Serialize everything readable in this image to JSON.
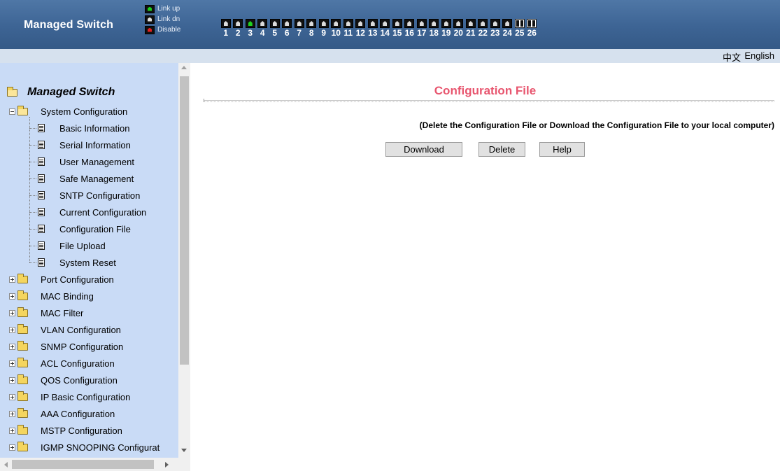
{
  "header": {
    "brand": "Managed Switch",
    "legend": [
      {
        "label": "Link up",
        "color": "#1fd11f"
      },
      {
        "label": "Link dn",
        "color": "#dcdcdc"
      },
      {
        "label": "Disable",
        "color": "#e02020"
      }
    ],
    "ports": [
      {
        "num": "1",
        "state": "down"
      },
      {
        "num": "2",
        "state": "down"
      },
      {
        "num": "3",
        "state": "up"
      },
      {
        "num": "4",
        "state": "down"
      },
      {
        "num": "5",
        "state": "down"
      },
      {
        "num": "6",
        "state": "down"
      },
      {
        "num": "7",
        "state": "down"
      },
      {
        "num": "8",
        "state": "down"
      },
      {
        "num": "9",
        "state": "down"
      },
      {
        "num": "10",
        "state": "down"
      },
      {
        "num": "11",
        "state": "down"
      },
      {
        "num": "12",
        "state": "down"
      },
      {
        "num": "13",
        "state": "down"
      },
      {
        "num": "14",
        "state": "down"
      },
      {
        "num": "15",
        "state": "down"
      },
      {
        "num": "16",
        "state": "down"
      },
      {
        "num": "17",
        "state": "down"
      },
      {
        "num": "18",
        "state": "down"
      },
      {
        "num": "19",
        "state": "down"
      },
      {
        "num": "20",
        "state": "down"
      },
      {
        "num": "21",
        "state": "down"
      },
      {
        "num": "22",
        "state": "down"
      },
      {
        "num": "23",
        "state": "down"
      },
      {
        "num": "24",
        "state": "down"
      },
      {
        "num": "25",
        "state": "combo"
      },
      {
        "num": "26",
        "state": "combo"
      }
    ]
  },
  "language": {
    "chinese": "中文",
    "english": "English"
  },
  "sidebar": {
    "root": "Managed Switch",
    "system_configuration": {
      "label": "System Configuration",
      "children": [
        "Basic Information",
        "Serial Information",
        "User Management",
        "Safe Management",
        "SNTP Configuration",
        "Current Configuration",
        "Configuration File",
        "File Upload",
        "System Reset"
      ]
    },
    "folders": [
      "Port Configuration",
      "MAC Binding",
      "MAC Filter",
      "VLAN Configuration",
      "SNMP Configuration",
      "ACL Configuration",
      "QOS Configuration",
      "IP Basic Configuration",
      "AAA Configuration",
      "MSTP Configuration",
      "IGMP SNOOPING Configurat"
    ]
  },
  "main": {
    "title": "Configuration File",
    "instruction": "(Delete the Configuration File or Download the Configuration File to your local computer)",
    "buttons": {
      "download": "Download",
      "delete": "Delete",
      "help": "Help"
    }
  }
}
